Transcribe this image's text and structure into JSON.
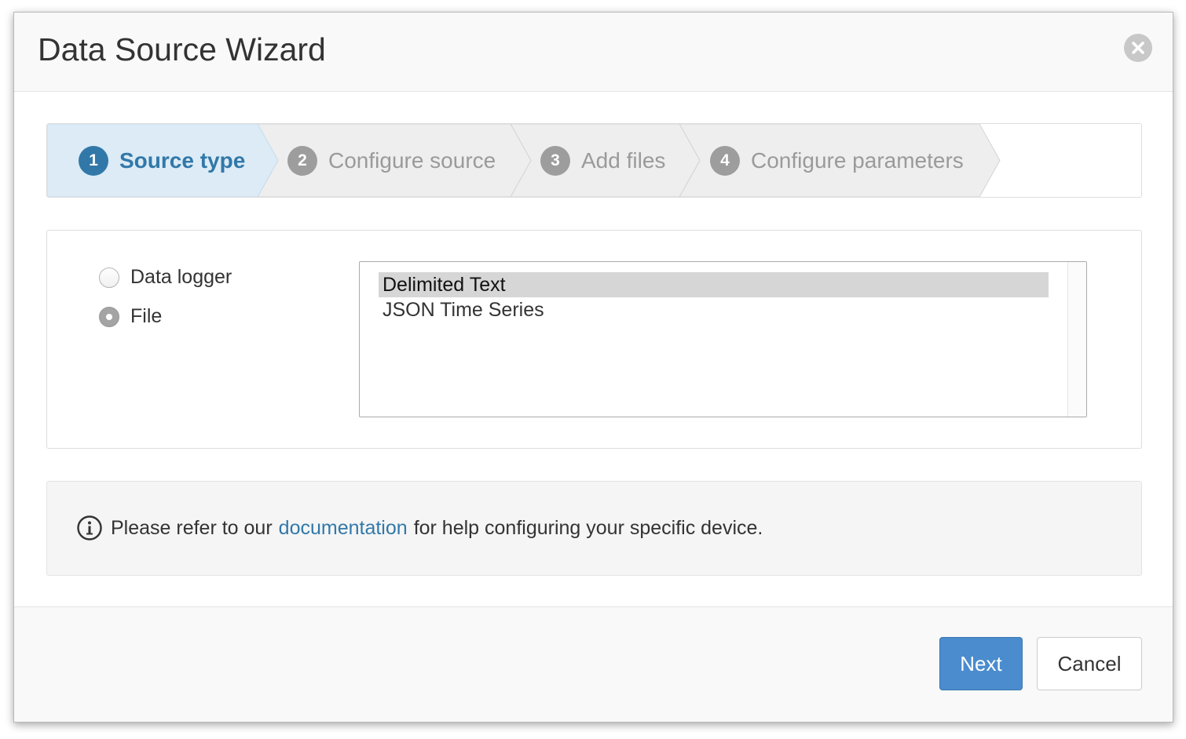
{
  "dialog": {
    "title": "Data Source Wizard",
    "close_icon": "close-circle-icon"
  },
  "steps": [
    {
      "number": "1",
      "label": "Source type",
      "state": "active"
    },
    {
      "number": "2",
      "label": "Configure source",
      "state": "inactive"
    },
    {
      "number": "3",
      "label": "Add files",
      "state": "inactive"
    },
    {
      "number": "4",
      "label": "Configure parameters",
      "state": "inactive"
    }
  ],
  "source": {
    "options": [
      {
        "label": "Data logger",
        "checked": false
      },
      {
        "label": "File",
        "checked": true
      }
    ],
    "file_types": [
      {
        "label": "Delimited Text",
        "selected": true
      },
      {
        "label": "JSON Time Series",
        "selected": false
      }
    ]
  },
  "info": {
    "icon": "info-circle-icon",
    "before_link": "Please refer to our",
    "link": "documentation",
    "after_link": "for help configuring your specific device."
  },
  "footer": {
    "next_label": "Next",
    "cancel_label": "Cancel"
  },
  "colors": {
    "active_step_bg": "#dcebf5",
    "active_step_text": "#3178a9",
    "inactive_step_bg": "#eeeeee",
    "primary_button": "#4a8ccd",
    "link": "#3178a9"
  }
}
